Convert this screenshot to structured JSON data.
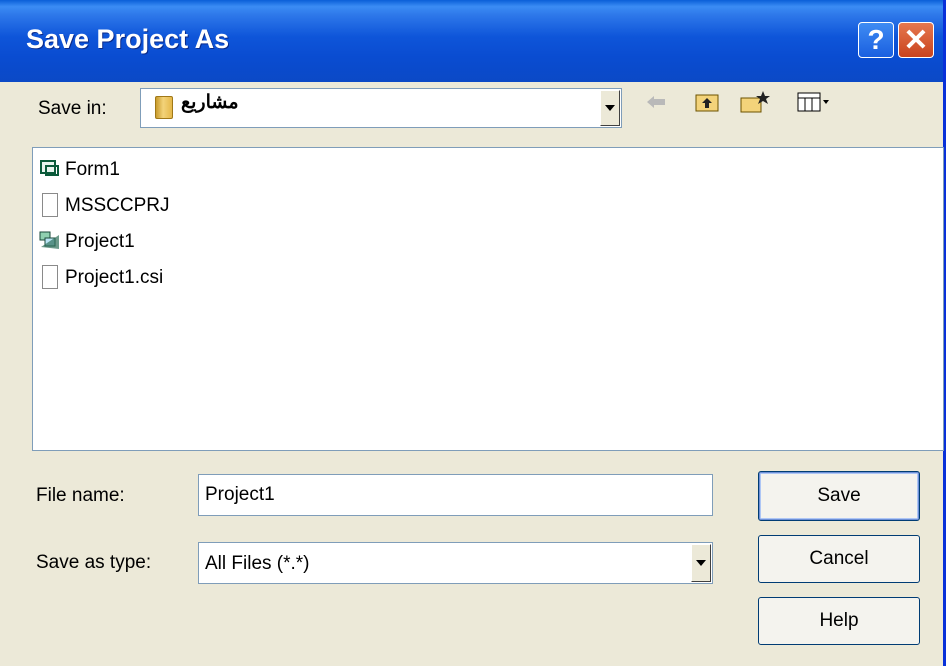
{
  "window": {
    "title": "Save Project As"
  },
  "titlebar": {
    "help_glyph": "?",
    "close_glyph": "✕"
  },
  "save_in": {
    "label": "Save in:",
    "value": "مشاريع"
  },
  "toolbar": {
    "back_icon": "back-arrow-icon",
    "up_icon": "up-folder-icon",
    "new_icon": "new-folder-icon",
    "views_icon": "views-menu-icon"
  },
  "files": [
    {
      "name": "Form1",
      "icon": "form-icon"
    },
    {
      "name": "MSSCCPRJ",
      "icon": "document-icon"
    },
    {
      "name": "Project1",
      "icon": "vb-project-icon"
    },
    {
      "name": "Project1.csi",
      "icon": "document-icon"
    }
  ],
  "file_name": {
    "label": "File name:",
    "value": "Project1"
  },
  "save_as_type": {
    "label": "Save as type:",
    "value": "All Files (*.*)"
  },
  "buttons": {
    "save": "Save",
    "cancel": "Cancel",
    "help": "Help"
  }
}
